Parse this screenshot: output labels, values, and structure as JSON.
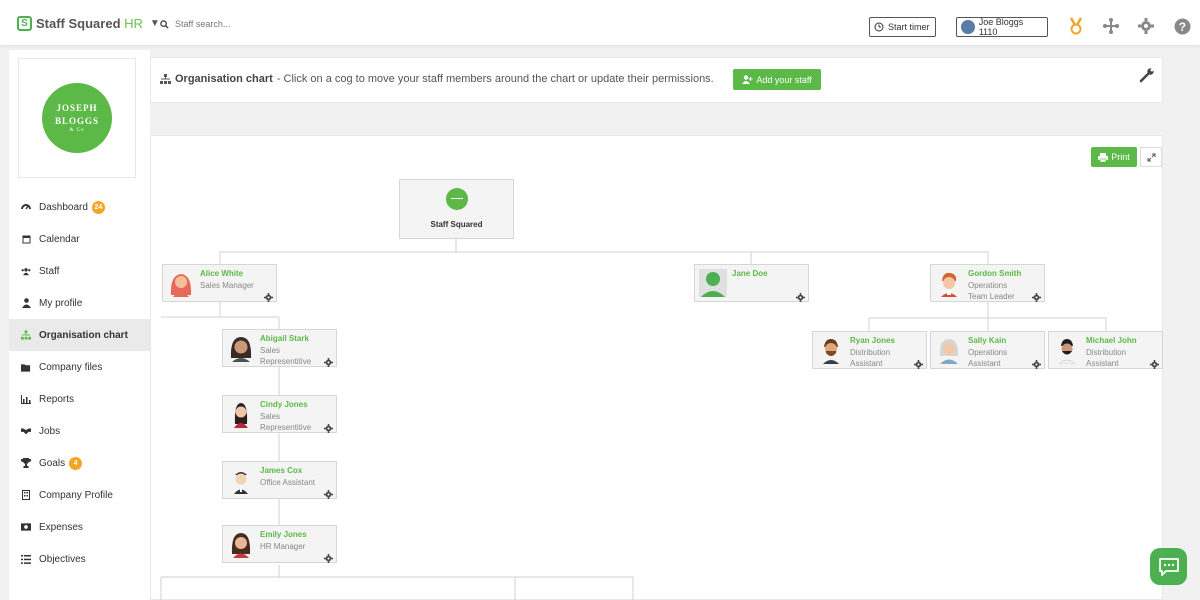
{
  "topbar": {
    "brand_name": "Staff Squared",
    "brand_suffix": "HR",
    "search_placeholder": "Staff search...",
    "start_timer_label": "Start timer",
    "user_label": "Joe Bloggs 1110"
  },
  "sidebar": {
    "company_logo_line1": "JOSEPH",
    "company_logo_line2": "BLOGGS",
    "company_logo_line3": "& Co",
    "items": [
      {
        "label": "Dashboard",
        "icon": "dashboard-icon",
        "badge": "24"
      },
      {
        "label": "Calendar",
        "icon": "calendar-icon"
      },
      {
        "label": "Staff",
        "icon": "users-icon"
      },
      {
        "label": "My profile",
        "icon": "user-icon"
      },
      {
        "label": "Organisation chart",
        "icon": "sitemap-icon"
      },
      {
        "label": "Company files",
        "icon": "folder-icon"
      },
      {
        "label": "Reports",
        "icon": "bar-chart-icon"
      },
      {
        "label": "Jobs",
        "icon": "handshake-icon"
      },
      {
        "label": "Goals",
        "icon": "trophy-icon",
        "badge": "4"
      },
      {
        "label": "Company Profile",
        "icon": "building-icon"
      },
      {
        "label": "Expenses",
        "icon": "money-icon"
      },
      {
        "label": "Objectives",
        "icon": "list-icon"
      }
    ]
  },
  "header": {
    "title": "Organisation chart",
    "description": "- Click on a cog to move your staff members around the chart or update their permissions.",
    "add_staff_label": "Add your staff"
  },
  "chart": {
    "print_label": "Print",
    "root_label": "Staff Squared",
    "nodes": [
      {
        "name": "Alice White",
        "title": "Sales Manager"
      },
      {
        "name": "Abigail Stark",
        "title": "Sales Representitive"
      },
      {
        "name": "Cindy Jones",
        "title": "Sales Representitive"
      },
      {
        "name": "James Cox",
        "title": "Office Assistant"
      },
      {
        "name": "Emily Jones",
        "title": "HR Manager"
      },
      {
        "name": "Jane Doe",
        "title": ""
      },
      {
        "name": "Gordon Smith",
        "title": "Operations Team Leader"
      },
      {
        "name": "Ryan Jones",
        "title": "Distribution Assistant"
      },
      {
        "name": "Sally Kain",
        "title": "Operations Assistant"
      },
      {
        "name": "Michael John",
        "title": "Distribution Assistant"
      }
    ]
  },
  "colors": {
    "brand_green": "#5cb847",
    "badge_orange": "#f5a524",
    "name_green": "#5cb847"
  }
}
